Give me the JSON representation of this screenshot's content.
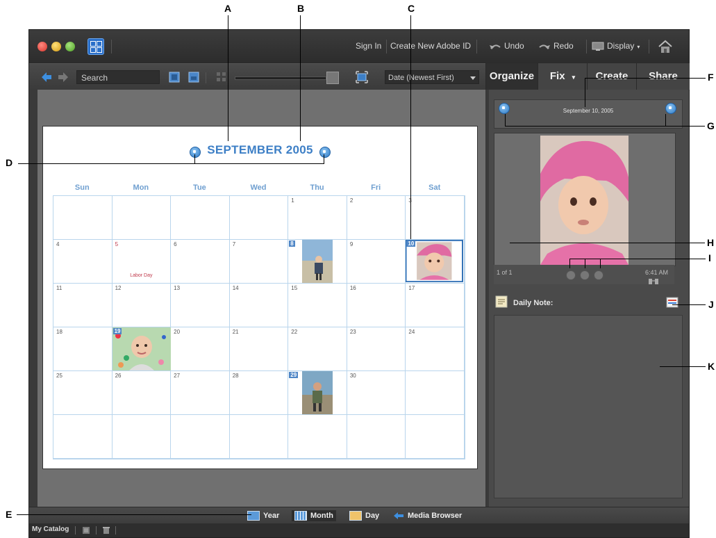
{
  "callouts": {
    "A": "A",
    "B": "B",
    "C": "C",
    "D": "D",
    "E": "E",
    "F": "F",
    "G": "G",
    "H": "H",
    "I": "I",
    "J": "J",
    "K": "K"
  },
  "topbar": {
    "sign_in": "Sign In",
    "create_id": "Create New Adobe ID",
    "undo": "Undo",
    "redo": "Redo",
    "display": "Display"
  },
  "toolbar": {
    "search_label": "Search",
    "sort_value": "Date (Newest First)"
  },
  "tabs": [
    {
      "label": "Organize"
    },
    {
      "label": "Fix"
    },
    {
      "label": "Create"
    },
    {
      "label": "Share"
    }
  ],
  "calendar": {
    "title": "SEPTEMBER 2005",
    "days_of_week": [
      "Sun",
      "Mon",
      "Tue",
      "Wed",
      "Thu",
      "Fri",
      "Sat"
    ],
    "holiday": "Labor Day",
    "dates": [
      "",
      "",
      "",
      "",
      "1",
      "2",
      "3",
      "4",
      "5",
      "6",
      "7",
      "8",
      "9",
      "10",
      "11",
      "12",
      "13",
      "14",
      "15",
      "16",
      "17",
      "18",
      "19",
      "20",
      "21",
      "22",
      "23",
      "24",
      "25",
      "26",
      "27",
      "28",
      "29",
      "30",
      "",
      "",
      "",
      "",
      "",
      "",
      "",
      "",
      ""
    ]
  },
  "right_panel": {
    "date_label": "September 10, 2005",
    "count": "1 of 1",
    "time": "6:41 AM",
    "note_label": "Daily Note:"
  },
  "viewbar": {
    "year": "Year",
    "month": "Month",
    "day": "Day",
    "media_browser": "Media Browser"
  },
  "statusbar": {
    "catalog": "My Catalog"
  },
  "colors": {
    "accent": "#3d7fc6",
    "grid_line": "#b9d5ec",
    "holiday": "#c0394b"
  }
}
